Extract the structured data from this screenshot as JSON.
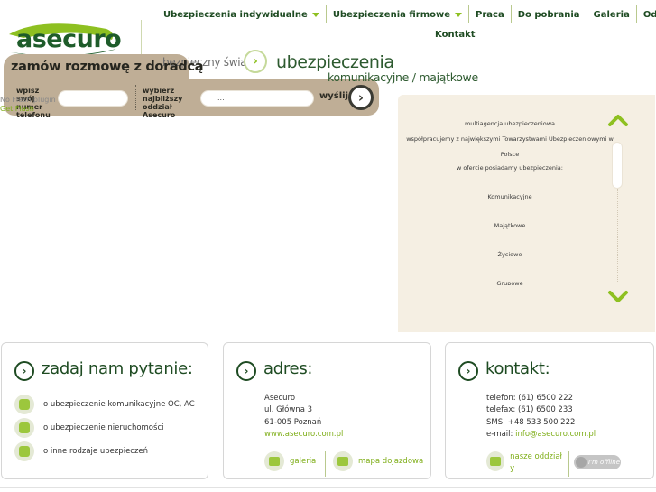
{
  "logo": {
    "text": "asecuro"
  },
  "nav": {
    "items": [
      {
        "label": "Ubezpieczenia indywidualne",
        "has_dropdown": true
      },
      {
        "label": "Ubezpieczenia firmowe",
        "has_dropdown": true
      },
      {
        "label": "Praca",
        "has_dropdown": false
      },
      {
        "label": "Do pobrania",
        "has_dropdown": false
      },
      {
        "label": "Galeria",
        "has_dropdown": false
      },
      {
        "label": "Oddziały",
        "has_dropdown": false
      }
    ],
    "second_row": "Kontakt"
  },
  "headline": {
    "small": "bezpieczny świat",
    "main": "ubezpieczenia",
    "sub": "komunikacyjne / majątkowe"
  },
  "callback": {
    "title": "zamów rozmowę z doradcą",
    "phone_label": "wpisz swój numer telefonu",
    "phone_value": "",
    "office_label": "wybierz najbliższy oddział Asecuro",
    "office_value": "...",
    "send_label": "wyślij"
  },
  "plugin_notice": {
    "text": "No Flash plugin",
    "link": "Get Flash"
  },
  "info_panel": {
    "lines": [
      "multiagencja ubezpieczeniowa",
      "współpracujemy z największymi Towarzystwami Ubezpieczeniowymi w",
      "Polsce",
      "w ofercie posiadamy ubezpieczenia:",
      "Komunikacyjne",
      "Majątkowe",
      "Życiowe",
      "Grupowe"
    ]
  },
  "card_question": {
    "title": "zadaj nam pytanie:",
    "items": [
      {
        "icon": "car-icon",
        "text": "o ubezpieczenie komunikacyjne OC, AC"
      },
      {
        "icon": "lock-icon",
        "text": "o ubezpieczenie nieruchomości"
      },
      {
        "icon": "leaf-icon",
        "text": "o inne rodzaje ubezpieczeń"
      }
    ]
  },
  "card_address": {
    "title": "adres:",
    "lines": [
      "Asecuro",
      "ul. Główna 3",
      "61-005 Poznań"
    ],
    "website": "www.asecuro.com.pl",
    "gallery_label": "galeria",
    "map_label": "mapa dojazdowa"
  },
  "card_contact": {
    "title": "kontakt:",
    "phone": "telefon: (61) 6500 222",
    "fax": "telefax: (61) 6500 233",
    "sms": "SMS: +48 533 500 222",
    "email_label": "e-mail:",
    "email": "info@asecuro.com.pl",
    "offices_label": "nasze oddział y",
    "offline_badge": "I'm offline"
  },
  "colors": {
    "brand_green": "#1e4b22",
    "accent_green": "#8ec021",
    "banner_tan": "#bfae96",
    "panel_bg": "#f5efe3"
  }
}
